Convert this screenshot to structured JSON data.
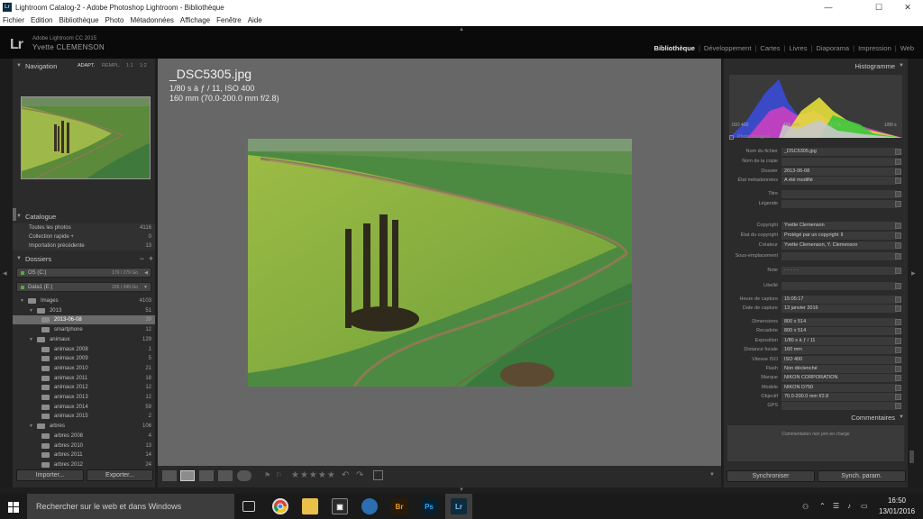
{
  "window": {
    "title": "Lightroom Catalog-2 - Adobe Photoshop Lightroom - Bibliothèque",
    "app_icon": "Lr",
    "minimize": "—",
    "maximize": "☐",
    "close": "✕"
  },
  "menu": [
    "Fichier",
    "Edition",
    "Bibliothèque",
    "Photo",
    "Métadonnées",
    "Affichage",
    "Fenêtre",
    "Aide"
  ],
  "identity": {
    "logo": "Lr",
    "version": "Adobe Lightroom CC 2015",
    "user": "Yvette CLEMENSON"
  },
  "modules": [
    {
      "label": "Bibliothèque",
      "active": true
    },
    {
      "label": "Développement"
    },
    {
      "label": "Cartes"
    },
    {
      "label": "Livres"
    },
    {
      "label": "Diaporama"
    },
    {
      "label": "Impression"
    },
    {
      "label": "Web"
    }
  ],
  "navigator": {
    "title": "Navigation",
    "modes": [
      "ADAPT.",
      "REMPL.",
      "1:1",
      "1:2"
    ]
  },
  "catalog": {
    "title": "Catalogue",
    "items": [
      {
        "label": "Toutes les photos",
        "count": "4116"
      },
      {
        "label": "Collection rapide +",
        "count": "0"
      },
      {
        "label": "Importation précédente",
        "count": "13"
      }
    ]
  },
  "folders": {
    "title": "Dossiers",
    "volumes": [
      {
        "label": "OS (C:)",
        "info": "179 / 279 Go"
      },
      {
        "label": "Data1 (E:)",
        "info": "226 / 349 Go"
      }
    ],
    "tree": [
      {
        "label": "Images",
        "count": "4103",
        "indent": 0
      },
      {
        "label": "2013",
        "count": "51",
        "indent": 1
      },
      {
        "label": "2013-06-08",
        "count": "39",
        "indent": 2,
        "selected": true
      },
      {
        "label": "smartphone",
        "count": "12",
        "indent": 2
      },
      {
        "label": "animaux",
        "count": "129",
        "indent": 1
      },
      {
        "label": "animaux 2008",
        "count": "1",
        "indent": 2
      },
      {
        "label": "animaux 2009",
        "count": "5",
        "indent": 2
      },
      {
        "label": "animaux 2010",
        "count": "21",
        "indent": 2
      },
      {
        "label": "animaux 2011",
        "count": "18",
        "indent": 2
      },
      {
        "label": "animaux 2012",
        "count": "12",
        "indent": 2
      },
      {
        "label": "animaux 2013",
        "count": "12",
        "indent": 2
      },
      {
        "label": "animaux 2014",
        "count": "59",
        "indent": 2
      },
      {
        "label": "animaux 2015",
        "count": "2",
        "indent": 2
      },
      {
        "label": "arbres",
        "count": "106",
        "indent": 1
      },
      {
        "label": "arbres 2008",
        "count": "4",
        "indent": 2
      },
      {
        "label": "arbres 2010",
        "count": "13",
        "indent": 2
      },
      {
        "label": "arbres 2011",
        "count": "14",
        "indent": 2
      },
      {
        "label": "arbres 2012",
        "count": "24",
        "indent": 2
      }
    ]
  },
  "left_buttons": {
    "import": "Importer...",
    "export": "Exporter..."
  },
  "photo": {
    "filename": "_DSC5305.jpg",
    "exposure": "1/80 s à ƒ / 11, ISO 400",
    "lens": "160 mm (70.0-200.0 mm f/2.8)"
  },
  "histogram": {
    "title": "Histogramme",
    "iso": "ISO 400",
    "focal": "160 mm",
    "aperture": "ƒ / 11",
    "shutter": "1/80 s",
    "original": "Photo d'origine"
  },
  "metadata": [
    {
      "label": "Nom du fichier",
      "value": "_DSC5305.jpg"
    },
    {
      "label": "Nom de la copie",
      "value": ""
    },
    {
      "label": "Dossier",
      "value": "2013-06-08"
    },
    {
      "label": "État métadonnées",
      "value": "A été modifié"
    },
    {
      "label": "Titre",
      "value": ""
    },
    {
      "label": "Légende",
      "value": ""
    },
    {
      "label": "Copyright",
      "value": "Yvette Clemenson"
    },
    {
      "label": "État du copyright",
      "value": "Protégé par un copyright ⇕"
    },
    {
      "label": "Créateur",
      "value": "Yvette Clemenson, Y. Clemenson"
    },
    {
      "label": "Sous-emplacement",
      "value": ""
    },
    {
      "label": "Note",
      "value": "·  ·  ·  ·  ·"
    },
    {
      "label": "Libellé",
      "value": ""
    },
    {
      "label": "Heure de capture",
      "value": "15:05:17"
    },
    {
      "label": "Date de capture",
      "value": "13 janvier 2016"
    },
    {
      "label": "Dimensions",
      "value": "800 x 514"
    },
    {
      "label": "Recadrée",
      "value": "800 x 514"
    },
    {
      "label": "Exposition",
      "value": "1/80 s à ƒ / 11"
    },
    {
      "label": "Distance focale",
      "value": "160 mm"
    },
    {
      "label": "Vitesse ISO",
      "value": "ISO 400"
    },
    {
      "label": "Flash",
      "value": "Non déclenché"
    },
    {
      "label": "Marque",
      "value": "NIKON CORPORATION"
    },
    {
      "label": "Modèle",
      "value": "NIKON D750"
    },
    {
      "label": "Objectif",
      "value": "70.0-200.0 mm f/2.8"
    },
    {
      "label": "GPS",
      "value": ""
    }
  ],
  "comments": {
    "title": "Commentaires",
    "placeholder": "Commentaires non pris en charge"
  },
  "right_buttons": {
    "sync": "Synchroniser",
    "sync_settings": "Synch. param."
  },
  "toolbar": {
    "stars": "★★★★★"
  },
  "taskbar": {
    "search": "Rechercher sur le web et dans Windows",
    "time": "16:50",
    "date": "13/01/2016",
    "apps": [
      "Br",
      "Ps",
      "Lr"
    ]
  },
  "colors": {
    "accent": "#e6e6e6",
    "panel": "#2b2b2b",
    "center": "#676767"
  }
}
